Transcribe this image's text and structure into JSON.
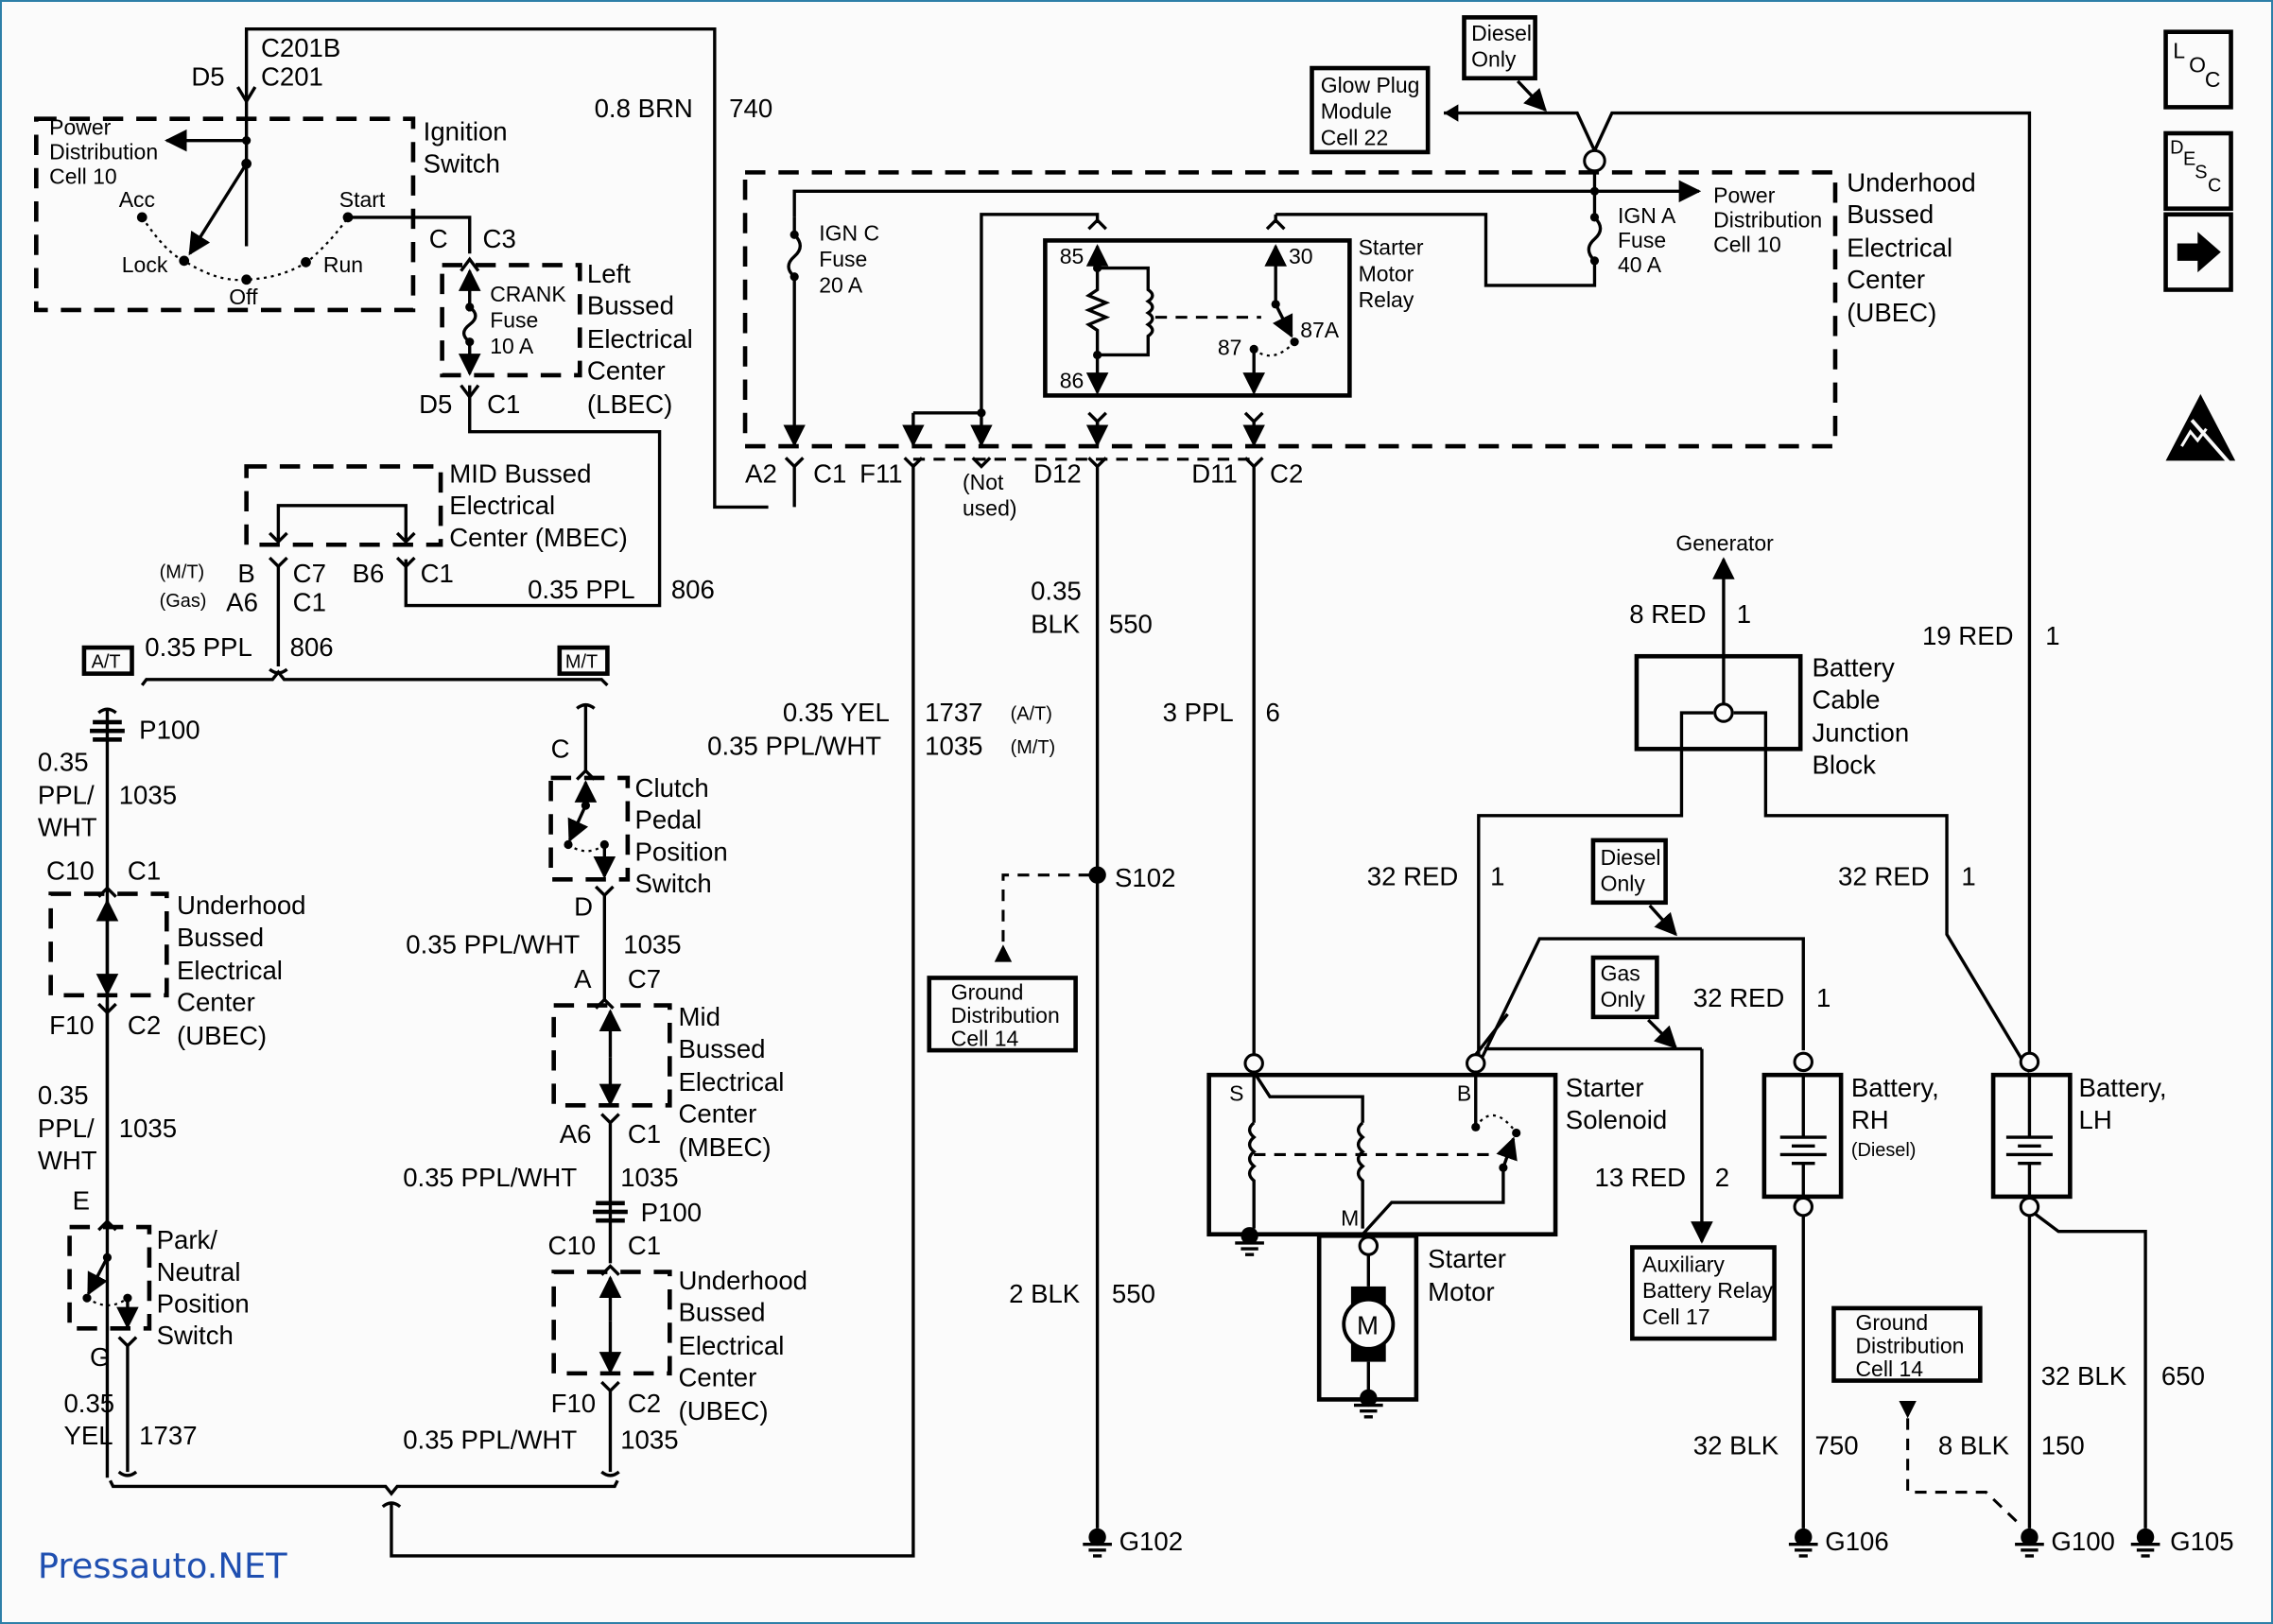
{
  "watermark": "Pressauto.NET",
  "side_icons": {
    "loc": "LOC",
    "desc": "DESC",
    "next": "arrow-right",
    "esd": "esd-warning"
  },
  "ignition": {
    "connector_top_1": "C201B",
    "connector_top_2": "C201",
    "pin_top": "D5",
    "title_1": "Ignition",
    "title_2": "Switch",
    "pdc_1": "Power",
    "pdc_2": "Distribution",
    "pdc_3": "Cell 10",
    "pos_acc": "Acc",
    "pos_lock": "Lock",
    "pos_off": "Off",
    "pos_run": "Run",
    "pos_start": "Start",
    "pin_c": "C",
    "conn_c3": "C3"
  },
  "lbec": {
    "title_1": "Left",
    "title_2": "Bussed",
    "title_3": "Electrical",
    "title_4": "Center",
    "title_5": "(LBEC)",
    "fuse_1": "CRANK",
    "fuse_2": "Fuse",
    "fuse_3": "10 A",
    "pin_bottom": "D5",
    "conn_bottom": "C1"
  },
  "wire_740": {
    "gauge": "0.8 BRN",
    "circuit": "740"
  },
  "mbec_top": {
    "title_1": "MID Bussed",
    "title_2": "Electrical",
    "title_3": "Center (MBEC)",
    "mt": "(M/T)",
    "gas": "(Gas)",
    "pin_b": "B",
    "pin_a6": "A6",
    "conn_c7": "C7",
    "conn_c1": "C1",
    "pin_b6": "B6",
    "conn_c1b": "C1",
    "wire_gauge": "0.35 PPL",
    "wire_circuit": "806",
    "wire2_gauge": "0.35 PPL",
    "wire2_circuit": "806"
  },
  "badges": {
    "at": "A/T",
    "mt": "M/T"
  },
  "at_branch": {
    "p100": "P100",
    "w1_gauge_1": "0.35",
    "w1_gauge_2": "PPL/",
    "w1_gauge_3": "WHT",
    "w1_circuit": "1035",
    "pin_c10": "C10",
    "conn_c1": "C1",
    "ubec_1": "Underhood",
    "ubec_2": "Bussed",
    "ubec_3": "Electrical",
    "ubec_4": "Center",
    "ubec_5": "(UBEC)",
    "pin_f10": "F10",
    "conn_c2": "C2",
    "w2_gauge_1": "0.35",
    "w2_gauge_2": "PPL/",
    "w2_gauge_3": "WHT",
    "w2_circuit": "1035",
    "pin_e": "E",
    "pnp_1": "Park/",
    "pnp_2": "Neutral",
    "pnp_3": "Position",
    "pnp_4": "Switch",
    "pin_g": "G",
    "w3_gauge_1": "0.35",
    "w3_gauge_2": "YEL",
    "w3_circuit": "1737"
  },
  "mt_branch": {
    "pin_c": "C",
    "cpp_1": "Clutch",
    "cpp_2": "Pedal",
    "cpp_3": "Position",
    "cpp_4": "Switch",
    "pin_d": "D",
    "w1_gauge": "0.35 PPL/WHT",
    "w1_circuit": "1035",
    "pin_a": "A",
    "conn_c7": "C7",
    "mbec_1": "Mid",
    "mbec_2": "Bussed",
    "mbec_3": "Electrical",
    "mbec_4": "Center",
    "mbec_5": "(MBEC)",
    "pin_a6": "A6",
    "conn_c1": "C1",
    "w2_gauge": "0.35 PPL/WHT",
    "w2_circuit": "1035",
    "p100": "P100",
    "pin_c10": "C10",
    "conn_c1b": "C1",
    "ubec_1": "Underhood",
    "ubec_2": "Bussed",
    "ubec_3": "Electrical",
    "ubec_4": "Center",
    "ubec_5": "(UBEC)",
    "pin_f10": "F10",
    "conn_c2": "C2",
    "w3_gauge": "0.35 PPL/WHT",
    "w3_circuit": "1035"
  },
  "f11_wire": {
    "g1": "0.35 YEL",
    "c1": "1737",
    "n1": "(A/T)",
    "g2": "0.35 PPL/WHT",
    "c2": "1035",
    "n2": "(M/T)"
  },
  "ubec_main": {
    "title_1": "Underhood",
    "title_2": "Bussed",
    "title_3": "Electrical",
    "title_4": "Center",
    "title_5": "(UBEC)",
    "ignc_1": "IGN C",
    "ignc_2": "Fuse",
    "ignc_3": "20 A",
    "igna_1": "IGN A",
    "igna_2": "Fuse",
    "igna_3": "40 A",
    "pdc_1": "Power",
    "pdc_2": "Distribution",
    "pdc_3": "Cell 10",
    "relay_1": "Starter",
    "relay_2": "Motor",
    "relay_3": "Relay",
    "r85": "85",
    "r86": "86",
    "r30": "30",
    "r87": "87",
    "r87a": "87A",
    "pin_a2": "A2",
    "conn_c1": "C1",
    "pin_f11": "F11",
    "not_used_1": "(Not",
    "not_used_2": "used)",
    "pin_d12": "D12",
    "pin_d11": "D11",
    "conn_c2": "C2"
  },
  "glow_plug": {
    "l1": "Glow Plug",
    "l2": "Module",
    "l3": "Cell 22"
  },
  "diesel_only_top": {
    "l1": "Diesel",
    "l2": "Only"
  },
  "wire_550": {
    "g1": "0.35",
    "g2": "BLK",
    "circuit": "550",
    "splice": "S102",
    "g3": "2 BLK",
    "circuit2": "550",
    "ground": "G102"
  },
  "gnd_dist_left": {
    "l1": "Ground",
    "l2": "Distribution",
    "l3": "Cell 14"
  },
  "wire_6": {
    "gauge": "3 PPL",
    "circuit": "6"
  },
  "generator": {
    "label": "Generator",
    "gauge": "8 RED",
    "circuit": "1"
  },
  "junction_block": {
    "l1": "Battery",
    "l2": "Cable",
    "l3": "Junction",
    "l4": "Block"
  },
  "wire_19": {
    "gauge": "19 RED",
    "circuit": "1"
  },
  "wire_32a": {
    "gauge": "32 RED",
    "circuit": "1"
  },
  "wire_32b": {
    "gauge": "32 RED",
    "circuit": "1"
  },
  "wire_32c": {
    "gauge": "32 RED",
    "circuit": "1"
  },
  "diesel_only_mid": {
    "l1": "Diesel",
    "l2": "Only"
  },
  "gas_only": {
    "l1": "Gas",
    "l2": "Only"
  },
  "solenoid": {
    "l1": "Starter",
    "l2": "Solenoid",
    "s": "S",
    "b": "B",
    "m": "M"
  },
  "motor": {
    "l1": "Starter",
    "l2": "Motor",
    "symbol": "M"
  },
  "wire_2": {
    "gauge": "13 RED",
    "circuit": "2"
  },
  "aux_relay": {
    "l1": "Auxiliary",
    "l2": "Battery Relay",
    "l3": "Cell 17"
  },
  "battery_rh": {
    "l1": "Battery,",
    "l2": "RH",
    "l3": "(Diesel)"
  },
  "battery_lh": {
    "l1": "Battery,",
    "l2": "LH"
  },
  "gnd_dist_right": {
    "l1": "Ground",
    "l2": "Distribution",
    "l3": "Cell 14"
  },
  "wire_750": {
    "gauge": "32 BLK",
    "circuit": "750",
    "ground": "G106"
  },
  "wire_150": {
    "gauge": "8 BLK",
    "circuit": "150",
    "ground": "G100"
  },
  "wire_650": {
    "gauge": "32 BLK",
    "circuit": "650",
    "ground": "G105"
  }
}
